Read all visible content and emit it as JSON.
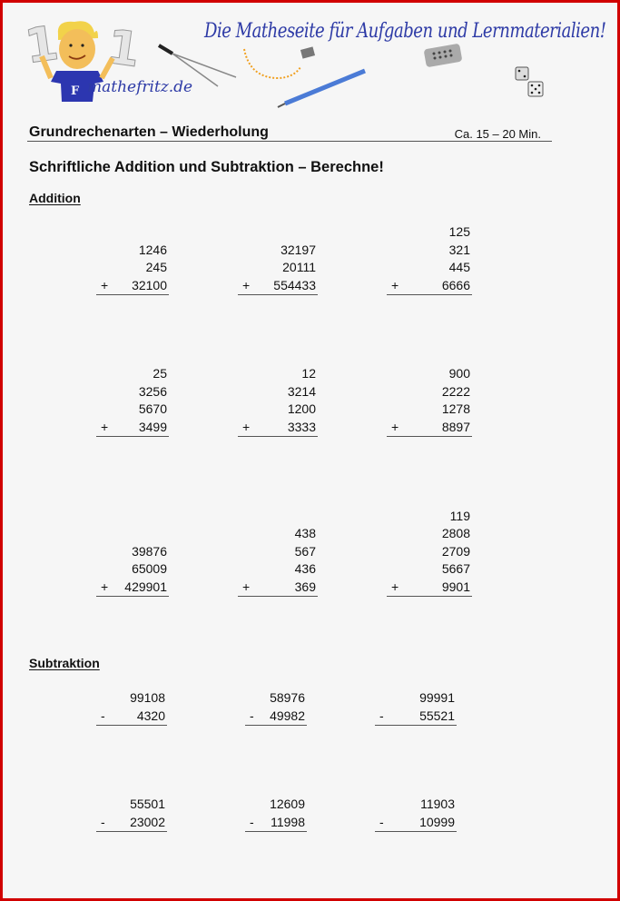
{
  "header": {
    "slogan": "Die Matheseite für Aufgaben und Lernmaterialien!",
    "brand": "mathefritz.de",
    "logo_digit": "1",
    "shirt_letter": "F"
  },
  "worksheet": {
    "title": "Grundrechenarten – Wiederholung",
    "duration": "Ca. 15 – 20 Min.",
    "instruction": "Schriftliche Addition und Subtraktion – Berechne!"
  },
  "addition": {
    "heading": "Addition",
    "operator": "+",
    "problems": [
      {
        "operands": [
          "1246",
          "245",
          "32100"
        ]
      },
      {
        "operands": [
          "32197",
          "20111",
          "554433"
        ]
      },
      {
        "operands": [
          "125",
          "321",
          "445",
          "6666"
        ]
      },
      {
        "operands": [
          "25",
          "3256",
          "5670",
          "3499"
        ]
      },
      {
        "operands": [
          "12",
          "3214",
          "1200",
          "3333"
        ]
      },
      {
        "operands": [
          "900",
          "2222",
          "1278",
          "8897"
        ]
      },
      {
        "operands": [
          "39876",
          "65009",
          "429901"
        ]
      },
      {
        "operands": [
          "438",
          "567",
          "436",
          "369"
        ]
      },
      {
        "operands": [
          "119",
          "2808",
          "2709",
          "5667",
          "9901"
        ]
      }
    ]
  },
  "subtraction": {
    "heading": "Subtraktion",
    "operator": "-",
    "problems": [
      {
        "operands": [
          "99108",
          "4320"
        ]
      },
      {
        "operands": [
          "58976",
          "49982"
        ]
      },
      {
        "operands": [
          "99991",
          "55521"
        ]
      },
      {
        "operands": [
          "55501",
          "23002"
        ]
      },
      {
        "operands": [
          "12609",
          "11998"
        ]
      },
      {
        "operands": [
          "11903",
          "10999"
        ]
      }
    ]
  },
  "colors": {
    "border": "#d10000",
    "brand_blue": "#2d3aa6",
    "background": "#f6f6f6"
  }
}
